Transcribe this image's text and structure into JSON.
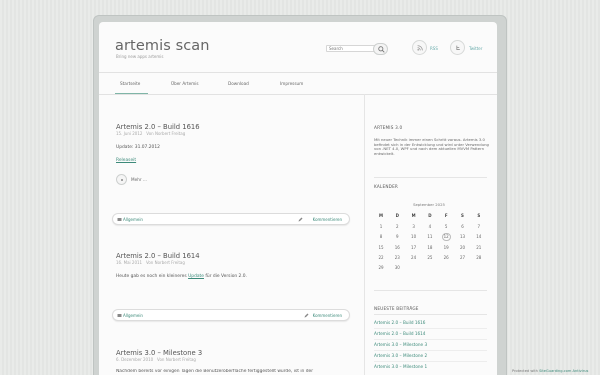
{
  "site": {
    "title": "artemis scan",
    "description": "Bring new apps artemis"
  },
  "search": {
    "placeholder": "Search"
  },
  "social": {
    "rss": "RSS",
    "twitter": "Twitter"
  },
  "nav": [
    "Startseite",
    "Über Artemis",
    "Download",
    "Impressum"
  ],
  "posts": [
    {
      "title": "Artemis 2.0 – Build 1616",
      "date": "15. Juni 2012",
      "author": "Von Norbert Freitag",
      "text": "Update: 31.07.2012",
      "link": "Releaseit",
      "more": "Mehr ...",
      "category": "Allgemein",
      "comments": "Kommentieren"
    },
    {
      "title": "Artemis 2.0 – Build 1614",
      "date": "16. Mai 2011",
      "author": "Von Norbert Freitag",
      "text_before": "Heute gab es noch ein kleineres ",
      "text_link": "Update",
      "text_after": " für die Version 2.0.",
      "category": "Allgemein",
      "comments": "Kommentieren"
    },
    {
      "title": "Artemis 3.0 – Milestone 3",
      "date": "6. Dezember 2010",
      "author": "Von Norbert Freitag",
      "text": "Nachdem bereits vor einigen Tagen die Benutzeroberfläche fertiggestellt wurde, ist in der"
    }
  ],
  "sidebar": {
    "about_title": "ARTEMIS 3.0",
    "about_text": "Mit neuer Technik immer einen Schritt voraus. Artemis 3.0 befindet sich in der Entwicklung und wird unter Verwendung von .NET 4.0, WPF und nach dem aktuellen MVVM Pattern entwickelt.",
    "calendar_title": "KALENDER",
    "calendar_month": "September 2025",
    "weekdays": [
      "M",
      "D",
      "M",
      "D",
      "F",
      "S",
      "S"
    ],
    "weeks": [
      [
        "1",
        "2",
        "3",
        "4",
        "5",
        "6",
        "7"
      ],
      [
        "8",
        "9",
        "10",
        "11",
        "12",
        "13",
        "14"
      ],
      [
        "15",
        "16",
        "17",
        "18",
        "19",
        "20",
        "21"
      ],
      [
        "22",
        "23",
        "24",
        "25",
        "26",
        "27",
        "28"
      ],
      [
        "29",
        "30",
        "",
        "",
        "",
        "",
        ""
      ]
    ],
    "today": "12",
    "recent_title": "NEUESTE BEITRÄGE",
    "recent": [
      "Artemis 2.0 – Build 1616",
      "Artemis 2.0 – Build 1614",
      "Artemis 3.0 – Milestone 3",
      "Artemis 3.0 – Milestone 2",
      "Artemis 3.0 – Milestone 1"
    ]
  },
  "footer": {
    "protected_prefix": "Protected with ",
    "protected_link": "SiteGuarding.com Antivirus"
  },
  "colors": {
    "accent": "#3c8a7a",
    "nav_active": "#7fb5a7"
  }
}
